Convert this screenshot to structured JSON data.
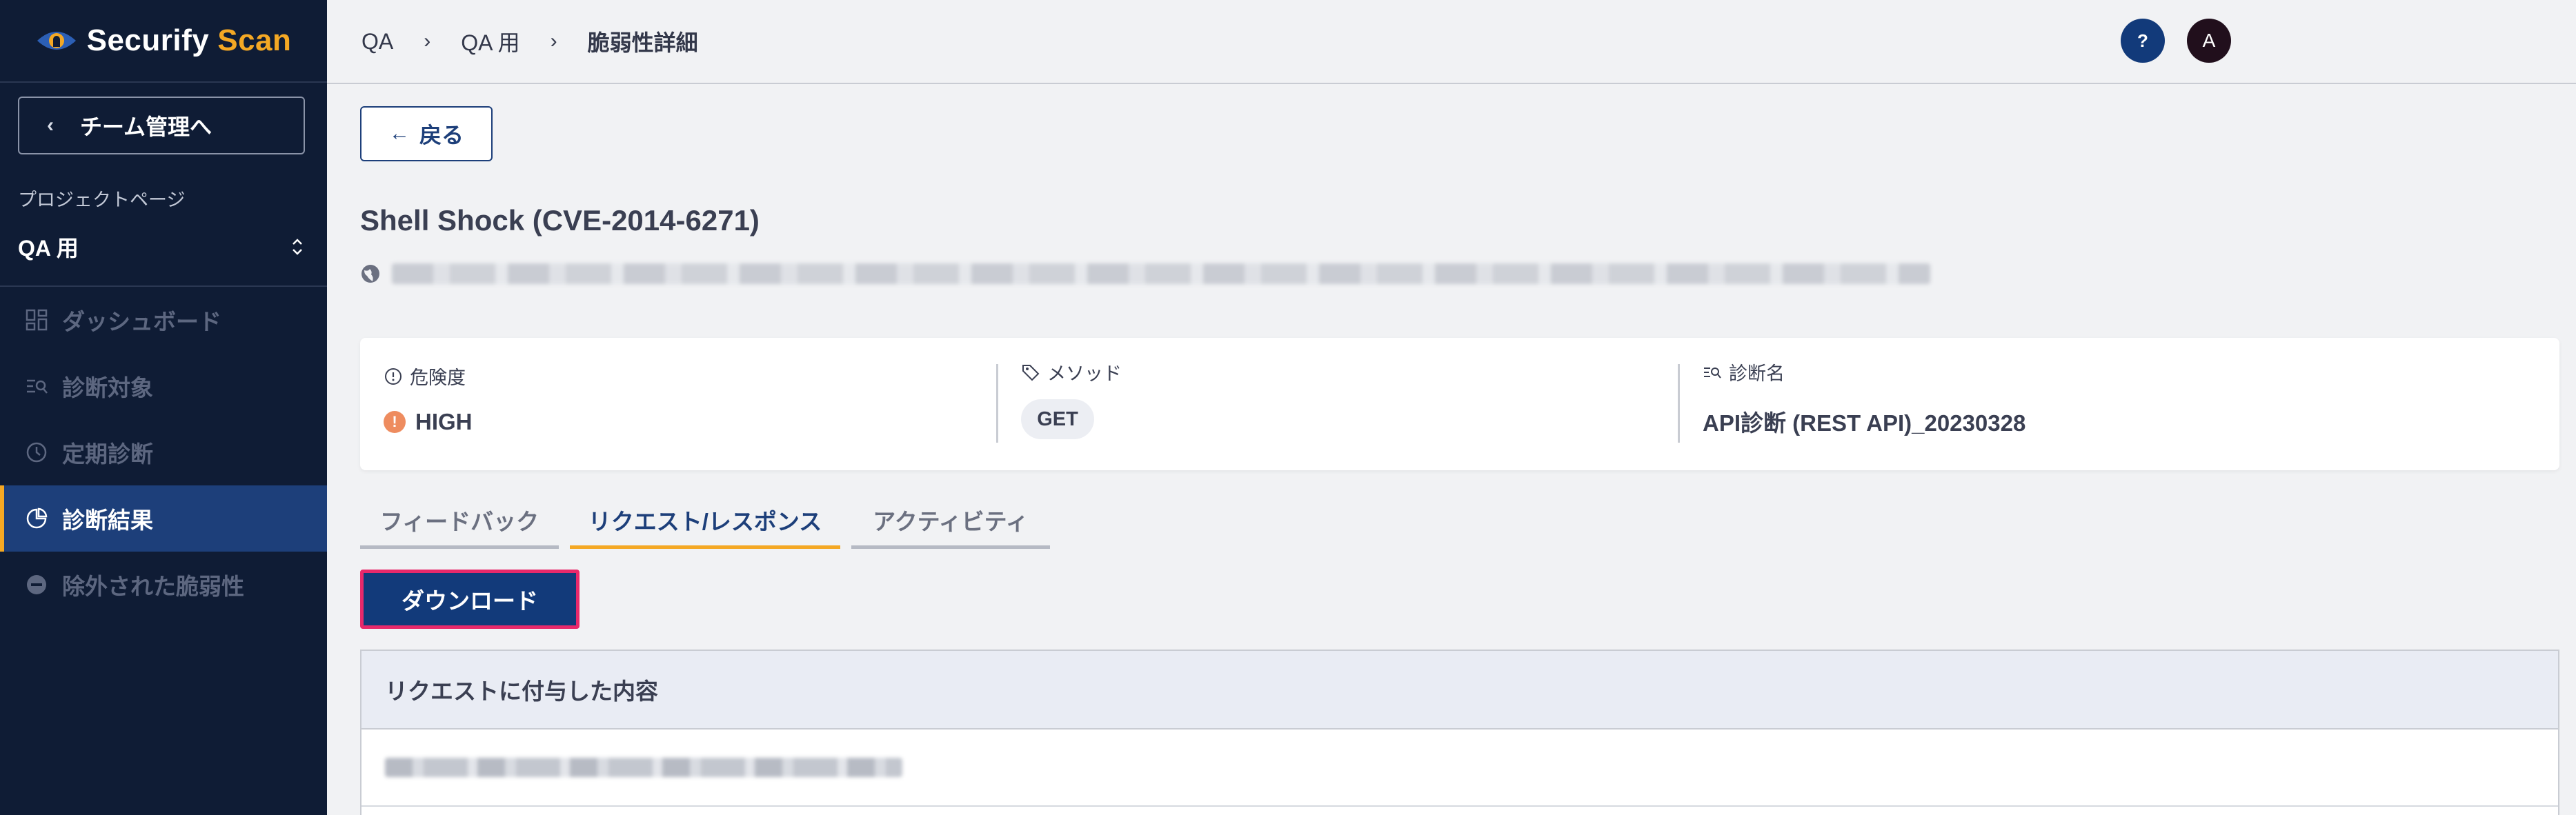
{
  "brand": {
    "name_part1": "Securify",
    "name_part2": "Scan",
    "accent": "#f4a824"
  },
  "sidebar": {
    "back_label": "チーム管理へ",
    "project_label": "プロジェクトページ",
    "project_name": "QA 用",
    "items": [
      {
        "label": "ダッシュボード",
        "icon": "dashboard-icon",
        "active": false
      },
      {
        "label": "診断対象",
        "icon": "scan-target-icon",
        "active": false
      },
      {
        "label": "定期診断",
        "icon": "clock-icon",
        "active": false
      },
      {
        "label": "診断結果",
        "icon": "pie-chart-icon",
        "active": true
      },
      {
        "label": "除外された脆弱性",
        "icon": "minus-circle-icon",
        "active": false
      }
    ]
  },
  "header": {
    "breadcrumbs": [
      "QA",
      "QA 用",
      "脆弱性詳細"
    ],
    "help_label": "?",
    "avatar_initial": "A"
  },
  "main": {
    "back_label": "戻る",
    "title": "Shell Shock (CVE-2014-6271)",
    "info": {
      "severity_label": "危険度",
      "severity_value": "HIGH",
      "severity_color": "#ee8c5f",
      "method_label": "メソッド",
      "method_value": "GET",
      "scan_label": "診断名",
      "scan_value": "API診断 (REST API)_20230328"
    },
    "tabs": [
      {
        "label": "フィードバック",
        "active": false
      },
      {
        "label": "リクエスト/レスポンス",
        "active": true
      },
      {
        "label": "アクティビティ",
        "active": false
      }
    ],
    "download_label": "ダウンロード",
    "request_section_title": "リクエストに付与した内容"
  },
  "colors": {
    "sidebar_bg": "#0f1c35",
    "primary": "#123a7a",
    "highlight_border": "#e8296b"
  }
}
